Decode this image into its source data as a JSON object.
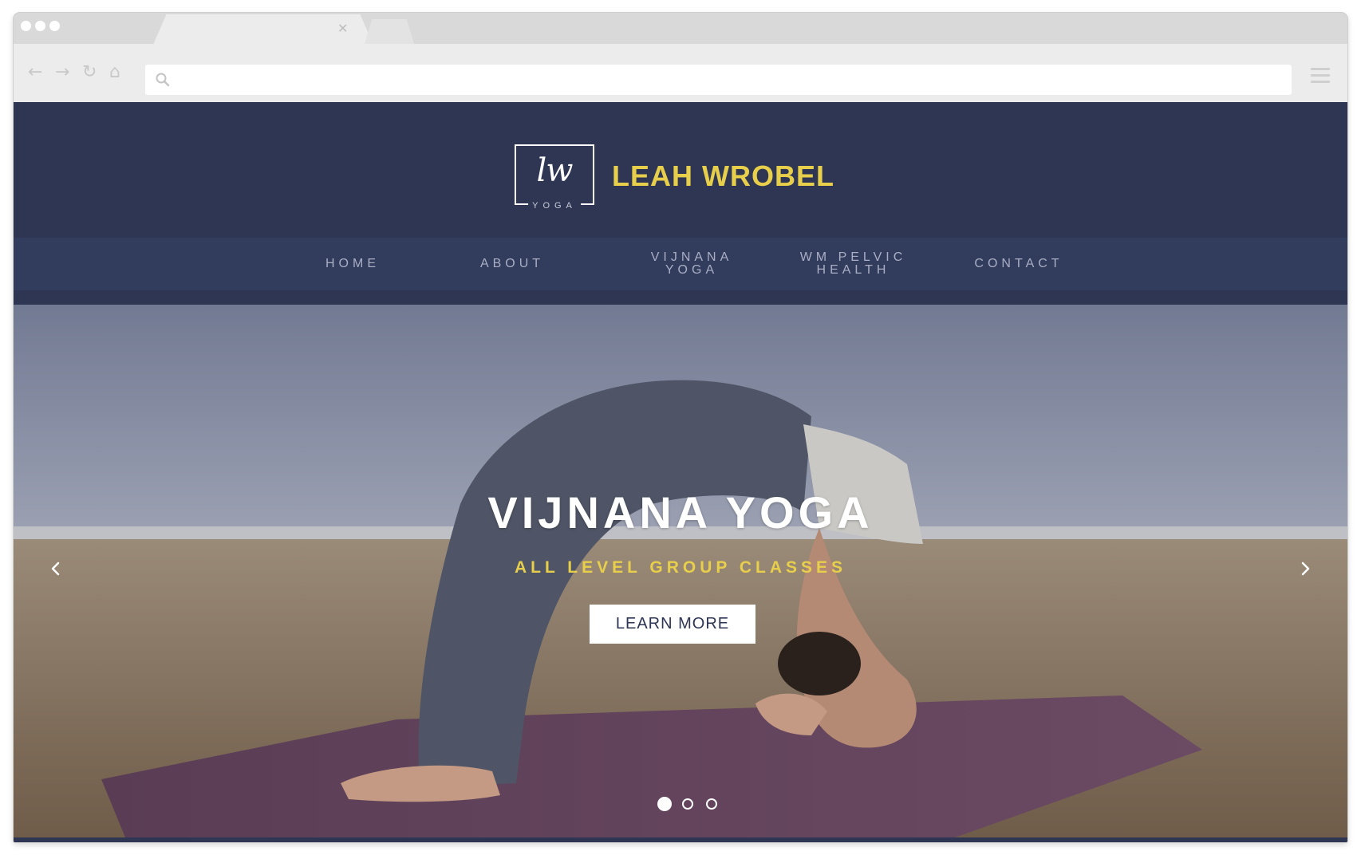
{
  "browser": {
    "controls": [
      "back-arrow-icon",
      "forward-arrow-icon",
      "reload-icon",
      "home-icon"
    ],
    "url_value": "",
    "tab_close_glyph": "✕"
  },
  "site": {
    "logo": {
      "script": "lw",
      "sub": "YOGA"
    },
    "brand_name": "LEAH WROBEL",
    "nav": [
      {
        "label": "HOME"
      },
      {
        "label": "ABOUT"
      },
      {
        "label": "VIJNANA\nYOGA"
      },
      {
        "label": "WM PELVIC\nHEALTH"
      },
      {
        "label": "CONTACT"
      }
    ]
  },
  "hero": {
    "title": "VIJNANA YOGA",
    "subtitle": "ALL LEVEL GROUP CLASSES",
    "cta_label": "LEARN MORE",
    "prev_icon": "chevron-left-icon",
    "next_icon": "chevron-right-icon",
    "slides_total": 3,
    "active_slide": 1
  },
  "colors": {
    "header_bg": "#2e3654",
    "nav_bg": "#323c5d",
    "brand_accent": "#e8cf4b",
    "nav_text": "#a9aec4",
    "mat": "#5e3e57"
  }
}
